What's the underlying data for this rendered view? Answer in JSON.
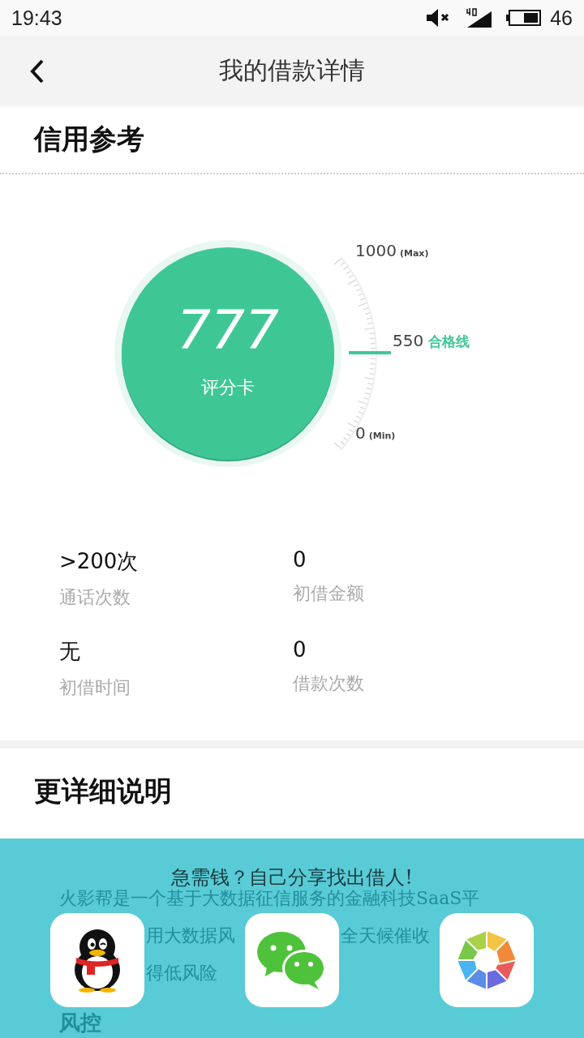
{
  "status_bar": {
    "time": "19:43",
    "battery": "46"
  },
  "nav": {
    "title": "我的借款详情"
  },
  "credit": {
    "heading": "信用参考",
    "score": "777",
    "score_label": "评分卡",
    "max_value": "1000",
    "max_note": "(Max)",
    "pass_value": "550",
    "pass_label": "合格线",
    "min_value": "0",
    "min_note": "(Min)",
    "stats": [
      {
        "value": ">200次",
        "label": "通话次数"
      },
      {
        "value": "0",
        "label": "初借金额"
      },
      {
        "value": "无",
        "label": "初借时间"
      },
      {
        "value": "0",
        "label": "借款次数"
      }
    ]
  },
  "details": {
    "heading": "更详细说明",
    "line_1": "火影帮是一个基于大数据征信服务的金融科技SaaS平",
    "line_2_left": "用大数据风",
    "line_2_right": "全天候催收",
    "line_3": "得低风险",
    "subheading": "风控"
  },
  "share": {
    "title": "急需钱？自己分享找出借人!",
    "targets": [
      {
        "kind": "qq"
      },
      {
        "kind": "wechat"
      },
      {
        "kind": "moments"
      }
    ]
  }
}
